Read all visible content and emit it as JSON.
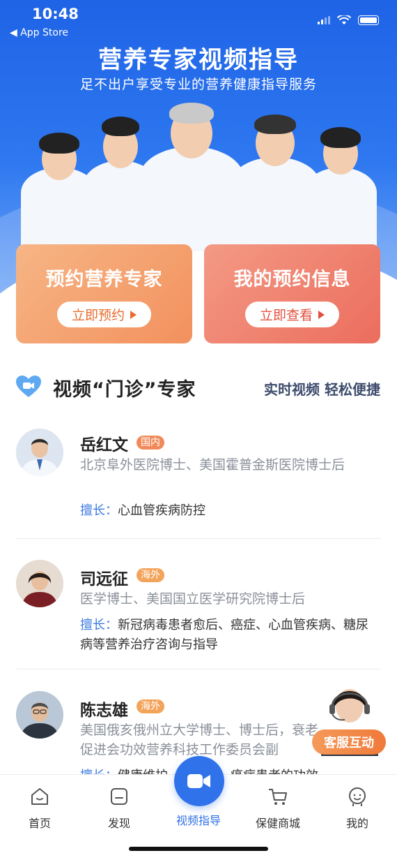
{
  "status": {
    "time": "10:48",
    "back_label": "◀ App Store"
  },
  "hero": {
    "title": "营养专家视频指导",
    "subtitle": "足不出户享受专业的营养健康指导服务"
  },
  "cards": [
    {
      "title": "预约营养专家",
      "button": "立即预约"
    },
    {
      "title": "我的预约信息",
      "button": "立即查看"
    }
  ],
  "section": {
    "title": "视频“门诊”专家",
    "right": "实时视频 轻松便捷",
    "icon": "video-heart-icon"
  },
  "experts": [
    {
      "name": "岳红文",
      "badge": "国内",
      "desc": "北京阜外医院博士、美国霍普金斯医院博士后",
      "spec_label": "擅长：",
      "spec": "心血管疾病防控"
    },
    {
      "name": "司远征",
      "badge": "海外",
      "desc": "医学博士、美国国立医学研究院博士后",
      "spec_label": "擅长：",
      "spec": "新冠病毒患者愈后、癌症、心血管疾病、糖尿病等营养治疗咨询与指导"
    },
    {
      "name": "陈志雄",
      "badge": "海外",
      "desc": "美国俄亥俄州立大学博士、博士后，衰老促进会功效营养科技工作委员会副",
      "spec_label": "擅长：",
      "spec": "健康维护……逆转、癌症患者的功效"
    }
  ],
  "customer_service": {
    "label": "客服互动"
  },
  "tabs": [
    {
      "label": "首页",
      "icon": "home-icon"
    },
    {
      "label": "发现",
      "icon": "discover-icon"
    },
    {
      "label": "视频指导",
      "icon": "video-camera-icon"
    },
    {
      "label": "保健商城",
      "icon": "cart-icon"
    },
    {
      "label": "我的",
      "icon": "profile-icon"
    }
  ],
  "colors": {
    "primary": "#2f72ea",
    "orange": "#ef7a3a",
    "coral": "#ec6d5e"
  }
}
